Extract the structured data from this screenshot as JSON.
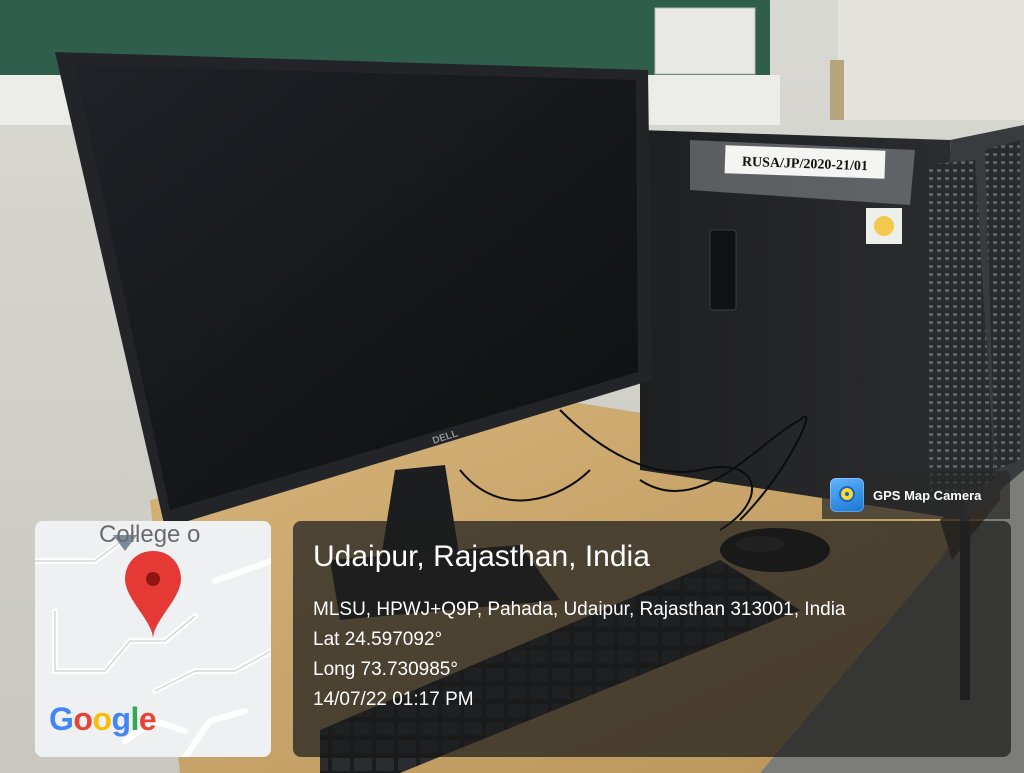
{
  "photo": {
    "tower_label": "RUSA/JP/2020-21/01",
    "monitor_brand": "DELL"
  },
  "gps_badge": {
    "app_name": "GPS Map Camera",
    "icon": "gps-map-camera-icon"
  },
  "map": {
    "place_label": "College o",
    "logo_text": "Google",
    "pin_icon": "map-pin-icon",
    "logo_colors": [
      "#4285F4",
      "#EA4335",
      "#FBBC05",
      "#4285F4",
      "#34A853",
      "#EA4335"
    ]
  },
  "location": {
    "title": "Udaipur, Rajasthan, India",
    "address": "MLSU, HPWJ+Q9P, Pahada, Udaipur, Rajasthan 313001, India",
    "latitude": "Lat 24.597092°",
    "longitude": "Long 73.730985°",
    "timestamp": "14/07/22 01:17 PM"
  }
}
